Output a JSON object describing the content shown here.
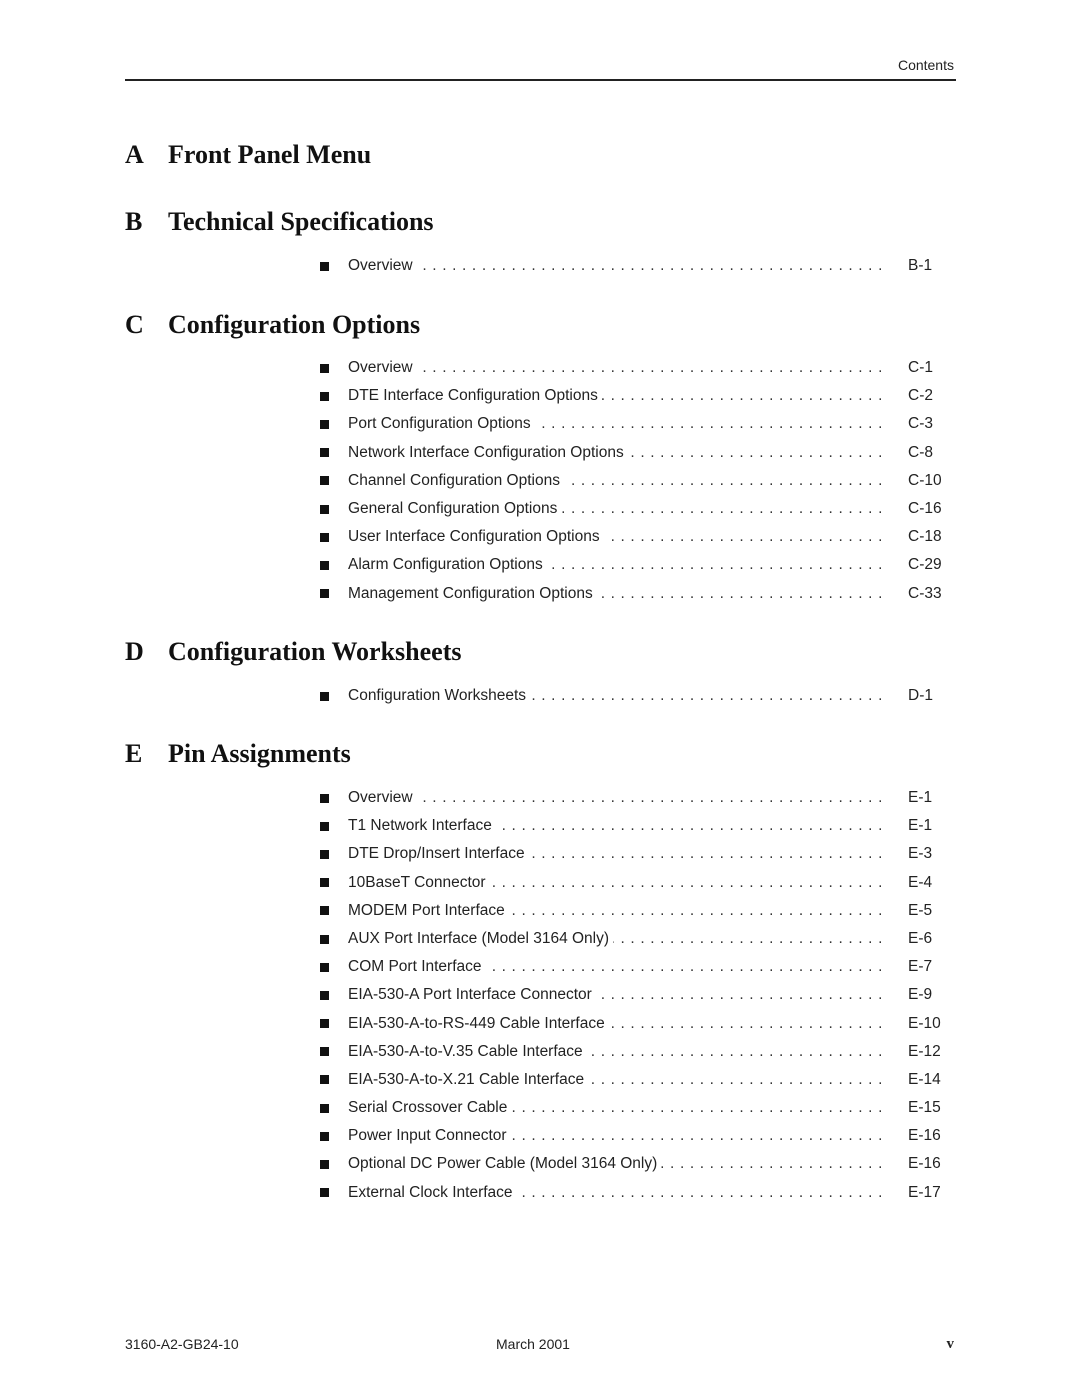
{
  "header": {
    "label": "Contents"
  },
  "sections": [
    {
      "letter": "A",
      "title": "Front Panel Menu",
      "entries": []
    },
    {
      "letter": "B",
      "title": "Technical Specifications",
      "entries": [
        {
          "title": "Overview",
          "page": "B-1"
        }
      ]
    },
    {
      "letter": "C",
      "title": "Configuration Options",
      "entries": [
        {
          "title": "Overview",
          "page": "C-1"
        },
        {
          "title": "DTE Interface Configuration Options",
          "page": "C-2"
        },
        {
          "title": "Port Configuration Options",
          "page": "C-3"
        },
        {
          "title": "Network Interface Configuration Options",
          "page": "C-8"
        },
        {
          "title": "Channel Configuration Options",
          "page": "C-10"
        },
        {
          "title": "General Configuration Options",
          "page": "C-16"
        },
        {
          "title": "User Interface Configuration Options",
          "page": "C-18"
        },
        {
          "title": "Alarm Configuration Options",
          "page": "C-29"
        },
        {
          "title": "Management Configuration Options",
          "page": "C-33"
        }
      ]
    },
    {
      "letter": "D",
      "title": "Configuration Worksheets",
      "entries": [
        {
          "title": "Configuration Worksheets",
          "page": "D-1"
        }
      ]
    },
    {
      "letter": "E",
      "title": "Pin Assignments",
      "entries": [
        {
          "title": "Overview",
          "page": "E-1"
        },
        {
          "title": "T1 Network Interface",
          "page": "E-1"
        },
        {
          "title": "DTE Drop/Insert Interface",
          "page": "E-3"
        },
        {
          "title": "10BaseT Connector",
          "page": "E-4"
        },
        {
          "title": "MODEM Port Interface",
          "page": "E-5"
        },
        {
          "title": "AUX Port Interface (Model 3164 Only)",
          "page": "E-6"
        },
        {
          "title": "COM Port Interface",
          "page": "E-7"
        },
        {
          "title": "EIA-530-A Port Interface Connector",
          "page": "E-9"
        },
        {
          "title": "EIA-530-A-to-RS-449 Cable Interface",
          "page": "E-10"
        },
        {
          "title": "EIA-530-A-to-V.35 Cable Interface",
          "page": "E-12"
        },
        {
          "title": "EIA-530-A-to-X.21 Cable Interface",
          "page": "E-14"
        },
        {
          "title": "Serial Crossover Cable",
          "page": "E-15"
        },
        {
          "title": "Power Input Connector",
          "page": "E-16"
        },
        {
          "title": "Optional DC Power Cable (Model 3164 Only)",
          "page": "E-16"
        },
        {
          "title": "External Clock Interface",
          "page": "E-17"
        }
      ]
    }
  ],
  "footer": {
    "doc_number": "3160-A2-GB24-10",
    "date": "March 2001",
    "page": "v"
  }
}
